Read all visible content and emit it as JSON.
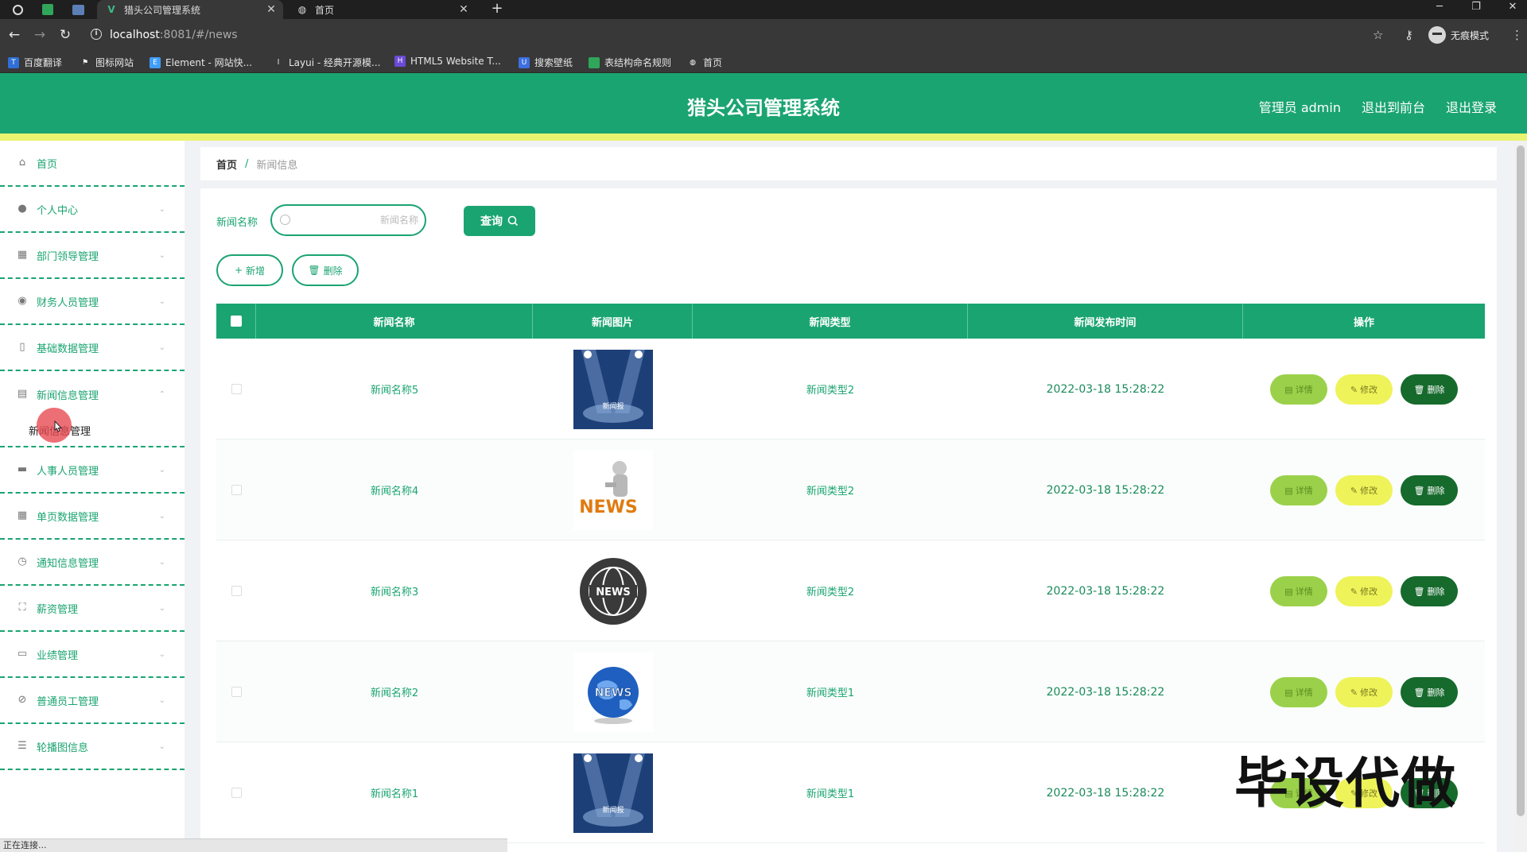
{
  "browser": {
    "tabs": [
      {
        "title": "猎头公司管理系统",
        "icon": "vue-logo-icon"
      },
      {
        "title": "首页",
        "icon": "globe-icon"
      }
    ],
    "url_host": "localhost",
    "url_path": ":8081/#/news",
    "incognito_label": "无痕模式",
    "bookmarks": [
      {
        "label": "百度翻译",
        "icon": "baidu-translate-icon",
        "color": "#2f6fd6"
      },
      {
        "label": "图标网站",
        "icon": "flag-icon",
        "color": "#555555"
      },
      {
        "label": "Element - 网站快...",
        "icon": "element-logo-icon",
        "color": "#409eff"
      },
      {
        "label": "Layui - 经典开源模...",
        "icon": "layui-logo-icon",
        "color": "#777777"
      },
      {
        "label": "HTML5 Website T...",
        "icon": "html5-template-icon",
        "color": "#6a4bd6"
      },
      {
        "label": "搜索壁纸",
        "icon": "wallpaper-icon",
        "color": "#3d6fe0"
      },
      {
        "label": "表结构命名规则",
        "icon": "sheet-icon",
        "color": "#2fa65a"
      },
      {
        "label": "首页",
        "icon": "globe-icon",
        "color": "#666666"
      }
    ]
  },
  "header": {
    "title": "猎头公司管理系统",
    "admin_label": "管理员 admin",
    "front_link": "退出到前台",
    "logout_link": "退出登录"
  },
  "sidebar": {
    "items": [
      {
        "label": "首页",
        "icon": "home-icon",
        "chevron": ""
      },
      {
        "label": "个人中心",
        "icon": "user-icon",
        "chevron": "⌄"
      },
      {
        "label": "部门领导管理",
        "icon": "grid-icon",
        "chevron": "⌄"
      },
      {
        "label": "财务人员管理",
        "icon": "location-icon",
        "chevron": "⌄"
      },
      {
        "label": "基础数据管理",
        "icon": "phone-icon",
        "chevron": "⌄"
      },
      {
        "label": "新闻信息管理",
        "icon": "news-icon",
        "chevron": "⌃"
      },
      {
        "label": "人事人员管理",
        "icon": "monitor-icon",
        "chevron": "⌄"
      },
      {
        "label": "单页数据管理",
        "icon": "apps-icon",
        "chevron": "⌄"
      },
      {
        "label": "通知信息管理",
        "icon": "clock-icon",
        "chevron": "⌄"
      },
      {
        "label": "薪资管理",
        "icon": "frame-icon",
        "chevron": "⌄"
      },
      {
        "label": "业绩管理",
        "icon": "chat-icon",
        "chevron": "⌄"
      },
      {
        "label": "普通员工管理",
        "icon": "tag-icon",
        "chevron": "⌄"
      },
      {
        "label": "轮播图信息",
        "icon": "menu-icon",
        "chevron": "⌄"
      }
    ],
    "sub_item": "新闻信息管理"
  },
  "breadcrumb": {
    "home": "首页",
    "separator": "/",
    "current": "新闻信息"
  },
  "search": {
    "label": "新闻名称",
    "placeholder": "新闻名称",
    "value": "",
    "query_button": "查询"
  },
  "actions": {
    "add": "新增",
    "delete": "删除"
  },
  "table": {
    "columns": [
      "新闻名称",
      "新闻图片",
      "新闻类型",
      "新闻发布时间",
      "操作"
    ],
    "rows": [
      {
        "name": "新闻名称5",
        "image": "stage-spotlight",
        "type": "新闻类型2",
        "time": "2022-03-18 15:28:22"
      },
      {
        "name": "新闻名称4",
        "image": "news-figure",
        "type": "新闻类型2",
        "time": "2022-03-18 15:28:22"
      },
      {
        "name": "新闻名称3",
        "image": "news-globe-dark",
        "type": "新闻类型2",
        "time": "2022-03-18 15:28:22"
      },
      {
        "name": "新闻名称2",
        "image": "news-globe-blue",
        "type": "新闻类型1",
        "time": "2022-03-18 15:28:22"
      },
      {
        "name": "新闻名称1",
        "image": "stage-spotlight",
        "type": "新闻类型1",
        "time": "2022-03-18 15:28:22"
      }
    ],
    "op_detail": "详情",
    "op_edit": "修改",
    "op_delete": "删除"
  },
  "thumb_text": {
    "stage_caption": "新闻报",
    "news": "NEWS"
  },
  "watermark": "毕设代做",
  "status_text": "正在连接..."
}
